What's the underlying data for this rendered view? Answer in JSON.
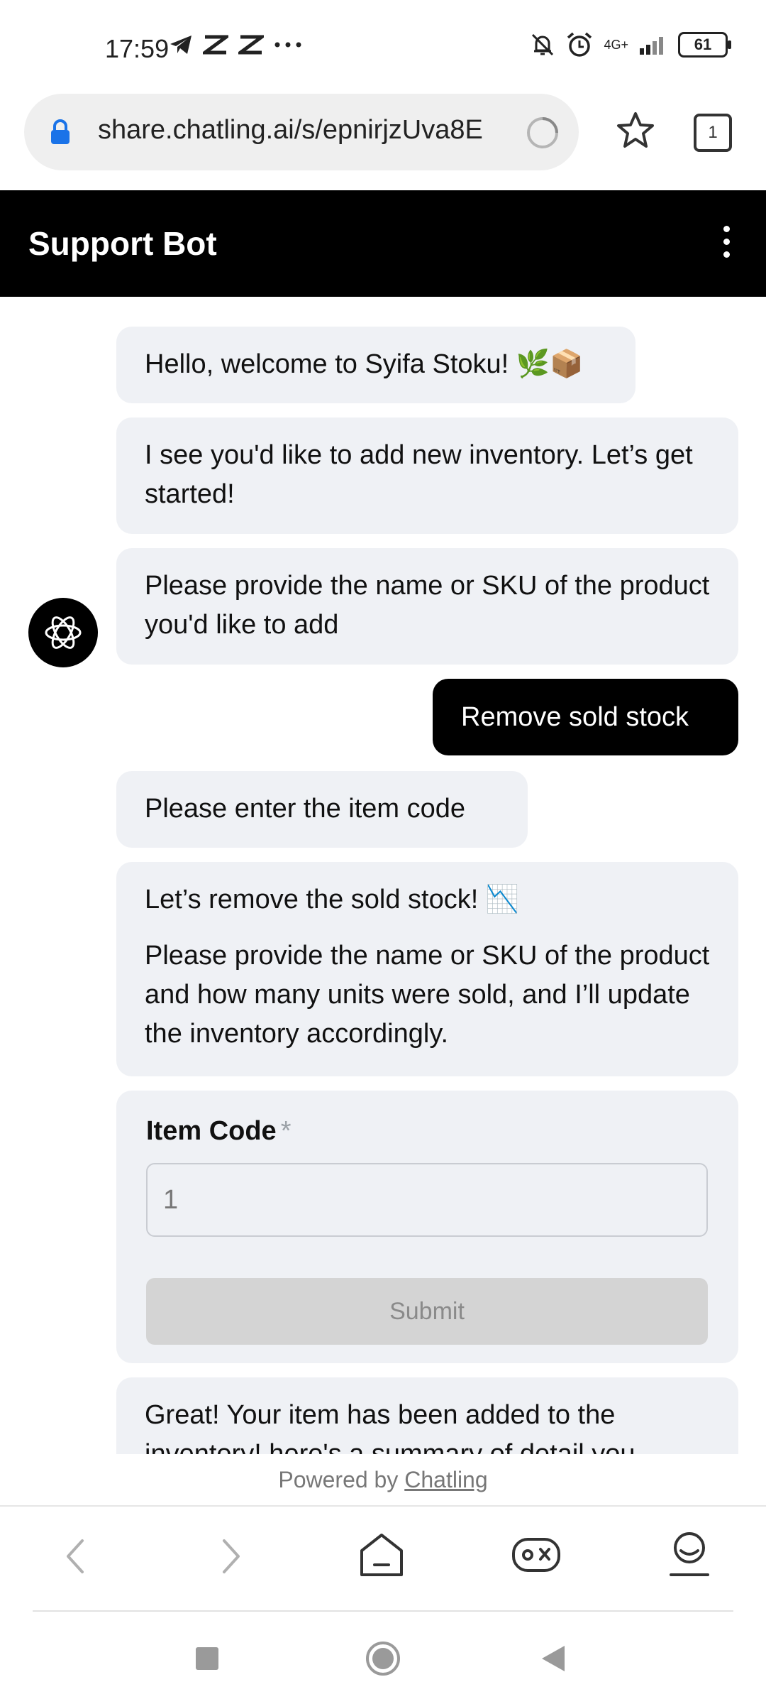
{
  "status_bar": {
    "time": "17:59",
    "left_icons": [
      "telegram-icon",
      "capcut-icon",
      "capcut-icon",
      "more-dots-icon"
    ],
    "network": "4G+",
    "battery": "61"
  },
  "browser": {
    "url": "share.chatling.ai/s/epnirjzUva8E",
    "tab_count": "1"
  },
  "chat": {
    "title": "Support Bot",
    "messages": [
      {
        "from": "bot",
        "text": "Hello, welcome to Syifa Stoku! 🌿📦"
      },
      {
        "from": "bot",
        "text": "I see you'd like to add new inventory. Let’s get started!"
      },
      {
        "from": "bot",
        "text": "Please provide the name or SKU of the product you'd like to add"
      },
      {
        "from": "user",
        "text": "Remove sold stock"
      },
      {
        "from": "bot",
        "text": "Please enter the item code"
      },
      {
        "from": "bot",
        "text": "Let’s remove the sold stock! 📉"
      },
      {
        "from": "bot",
        "text": "Please provide the name or SKU of the product and how many units were sold, and I’ll update the inventory accordingly."
      },
      {
        "from": "bot",
        "text": "Great! Your item has been added to the inventory! here's a summary of detail you"
      }
    ],
    "form": {
      "label": "Item Code",
      "required_mark": "*",
      "value": "1",
      "submit_label": "Submit"
    }
  },
  "footer": {
    "powered_prefix": "Powered by ",
    "powered_link": "Chatling"
  },
  "browser_nav": [
    "back-icon",
    "forward-icon",
    "home-icon",
    "games-icon",
    "profile-icon"
  ],
  "system_nav": [
    "recents-icon",
    "home-icon",
    "back-icon"
  ]
}
